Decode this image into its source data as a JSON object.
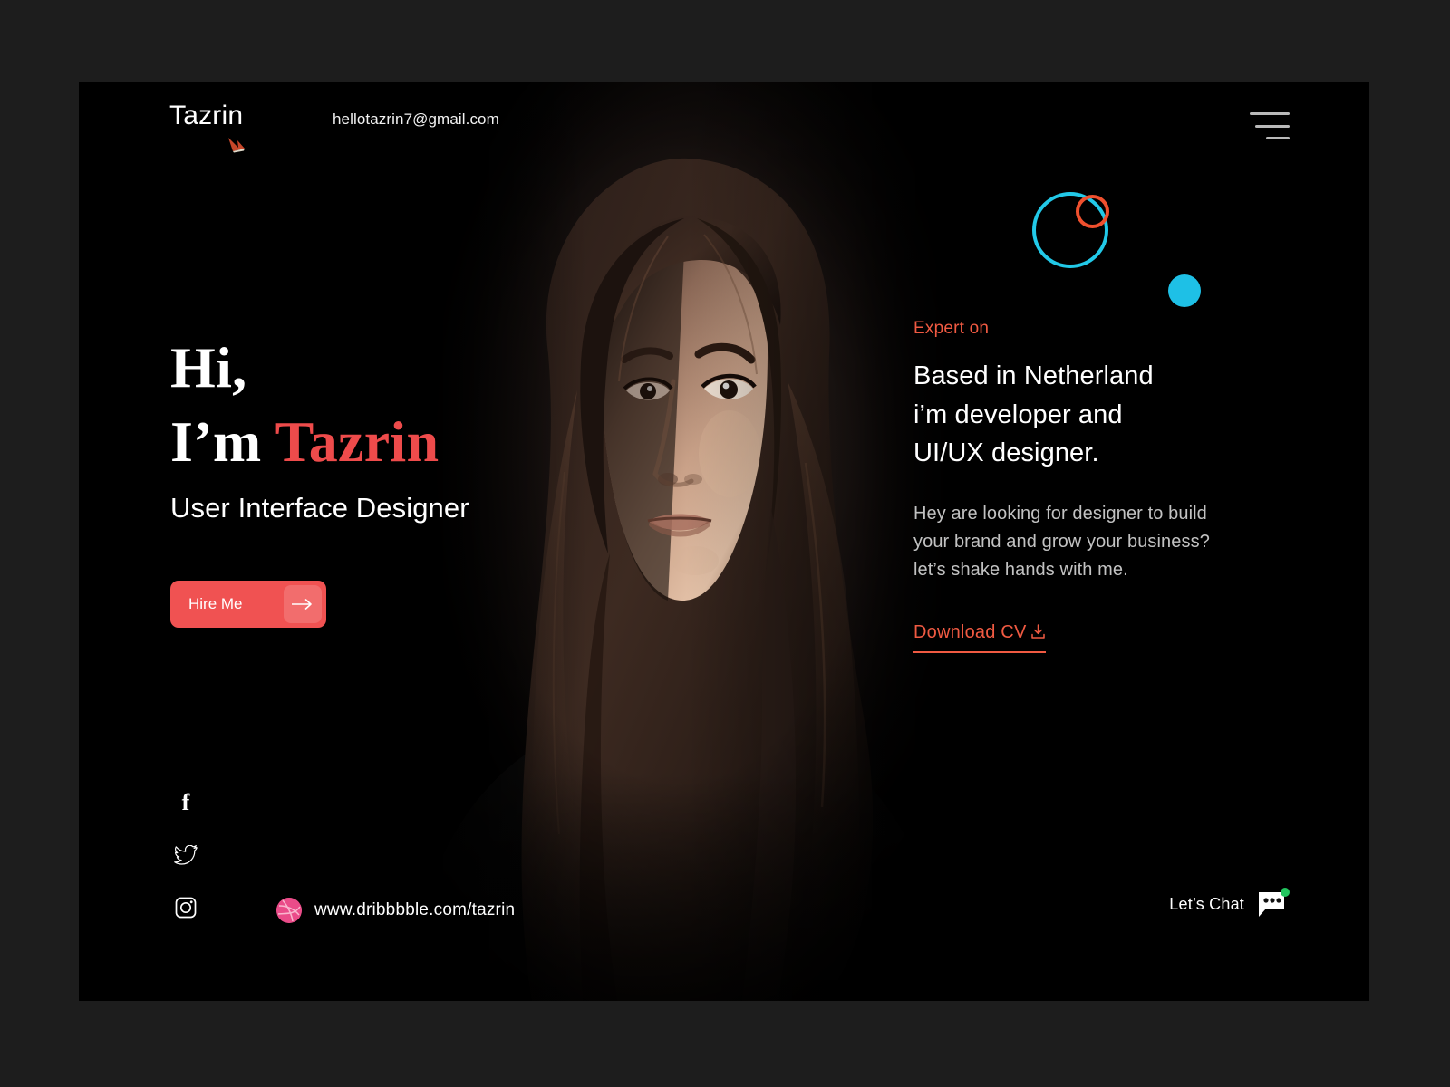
{
  "brand": {
    "name": "Tazrin",
    "mark_icon": "arrow-swoosh-icon",
    "mark_color": "#c8472a"
  },
  "header": {
    "email": "hellotazrin7@gmail.com",
    "menu_icon": "hamburger-menu-icon"
  },
  "decor": {
    "cyan_ring_color": "#22c9e8",
    "orange_ring_color": "#f0502e",
    "cyan_dot_color": "#1ec0e6"
  },
  "intro": {
    "greeting": "Hi,",
    "name_prefix": "I’m ",
    "name": "Tazrin",
    "name_color": "#ee4b4b",
    "role": "User Interface Designer",
    "cta_label": "Hire Me",
    "cta_icon": "arrow-right-icon",
    "cta_color": "#f05252"
  },
  "social": {
    "items": [
      {
        "icon": "facebook-icon",
        "label": "f"
      },
      {
        "icon": "twitter-icon",
        "label": ""
      },
      {
        "icon": "instagram-icon",
        "label": ""
      }
    ],
    "dribbble": {
      "icon": "dribbble-icon",
      "color": "#ea4c89",
      "url": "www.dribbbble.com/tazrin"
    }
  },
  "about": {
    "eyebrow": "Expert on",
    "eyebrow_color": "#f05a42",
    "headline_lines": [
      "Based in Netherland",
      "i’m developer and",
      "UI/UX designer."
    ],
    "body_lines": [
      "Hey are looking for designer to build",
      "your brand and grow your business?",
      "let’s shake hands with me."
    ],
    "cv_label": "Download CV",
    "cv_icon": "download-icon"
  },
  "chat": {
    "label": "Let’s Chat",
    "icon": "chat-bubble-icon",
    "status_color": "#22c55e"
  },
  "portrait": {
    "alt": "portrait-photo-woman"
  }
}
